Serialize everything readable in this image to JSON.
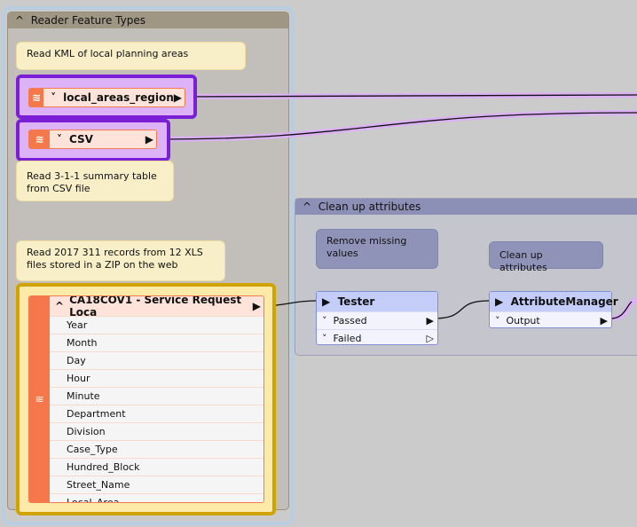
{
  "reader_bookmark": {
    "title": "Reader Feature Types"
  },
  "cleanup_bookmark": {
    "title": "Clean up attributes"
  },
  "annotations": {
    "kml": "Read KML of local planning areas",
    "csv": "Read 3-1-1 summary table from CSV file",
    "xls": "Read 2017 311 records from 12 XLS files stored in a ZIP on the web",
    "remove": "Remove missing values",
    "cleanup": "Clean up attributes"
  },
  "readers": {
    "local": {
      "name": "local_areas_region"
    },
    "csv": {
      "name": "CSV"
    },
    "service": {
      "name": "CA18COV1 - Service Request Loca",
      "attributes": [
        "Year",
        "Month",
        "Day",
        "Hour",
        "Minute",
        "Department",
        "Division",
        "Case_Type",
        "Hundred_Block",
        "Street_Name",
        "Local_Area"
      ]
    }
  },
  "transformers": {
    "tester": {
      "name": "Tester",
      "ports": [
        "Passed",
        "Failed"
      ]
    },
    "attrmgr": {
      "name": "AttributeManager",
      "ports": [
        "Output"
      ]
    }
  },
  "colors": {
    "selection": "#7a1fd5",
    "selected_reader": "#d1a300",
    "reader": "#f5784a",
    "transformer": "#c4ccf8"
  },
  "icons": {
    "reader": "layers-icon",
    "collapse": "chevron-up-icon",
    "expand": "chevron-down-icon",
    "output_port": "triangle-right-icon"
  }
}
